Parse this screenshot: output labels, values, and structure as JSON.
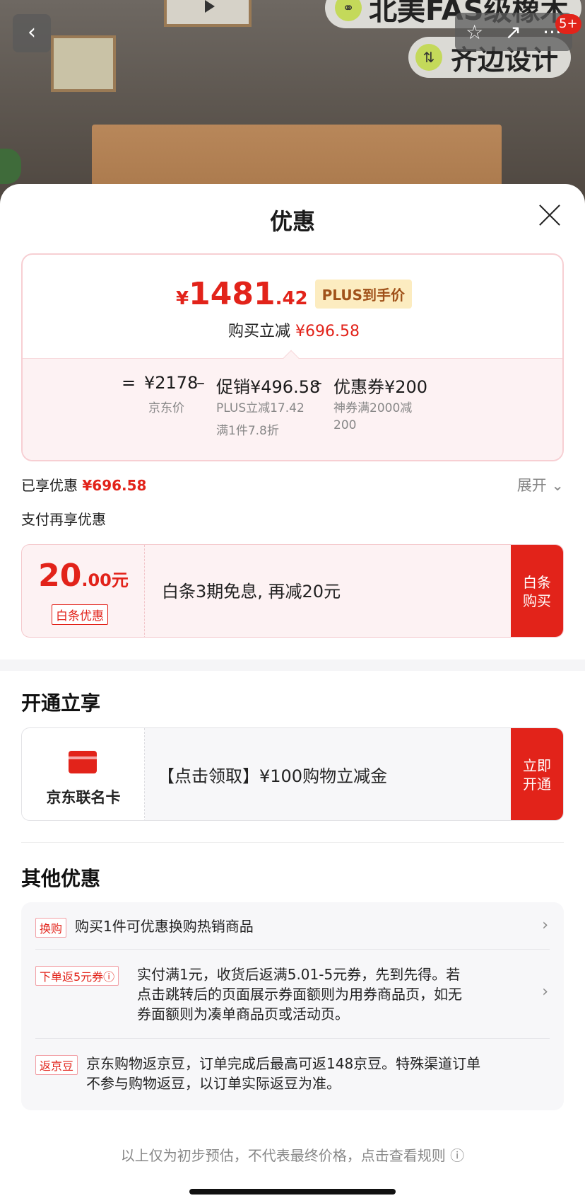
{
  "background": {
    "feature_1": "北美FAS级橡木",
    "feature_2": "齐边设计",
    "notification_count": "5+",
    "back_glyph": "‹",
    "star_glyph": "☆",
    "share_glyph": "↗",
    "more_glyph": "···",
    "feature_1_icon": "⚭",
    "feature_2_icon": "⇅"
  },
  "sheet": {
    "title": "优惠"
  },
  "price_card": {
    "currency": "¥",
    "price_int": "1481",
    "price_dec": ".42",
    "plus_label": "PLUS到手价",
    "reduce_label": "购买立减",
    "reduce_value": "¥696.58",
    "formula": {
      "equals": "=",
      "jd_price": "¥2178",
      "minus_1": "–",
      "promo": "促销¥496.58",
      "minus_2": "–",
      "coupon": "优惠券¥200",
      "jd_price_sub": "京东价",
      "promo_sub_1": "PLUS立减17.42",
      "promo_sub_2": "满1件7.8折",
      "coupon_sub_1": "神券满2000减",
      "coupon_sub_2": "200"
    }
  },
  "enjoyed": {
    "label": "已享优惠",
    "value": "¥696.58",
    "expand_label": "展开",
    "expand_icon": "⌄"
  },
  "pay_more": {
    "label": "支付再享优惠"
  },
  "baitiao": {
    "amount_int": "20",
    "amount_dec": ".00元",
    "tag": "白条优惠",
    "text": "白条3期免息, 再减20元",
    "button_line1": "白条",
    "button_line2": "购买"
  },
  "open_section": {
    "title": "开通立享",
    "card_name": "京东联名卡",
    "text": "【点击领取】¥100购物立减金",
    "button_line1": "立即",
    "button_line2": "开通"
  },
  "other_section": {
    "title": "其他优惠",
    "items": [
      {
        "tag": "换购",
        "text": "购买1件可优惠换购热销商品",
        "arrow": "›"
      },
      {
        "tag": "下单返5元券ⓘ",
        "text_line1": "实付满1元，收货后返满5.01-5元券，先到先得。若",
        "text_line2": "点击跳转后的页面展示券面额则为用券商品页，如无",
        "text_line3": "券面额则为凑单商品页或活动页。",
        "arrow": "›"
      },
      {
        "tag": "返京豆",
        "text_line1": "京东购物返京豆，订单完成后最高可返148京豆。特殊渠道订单",
        "text_line2": "不参与购物返豆，以订单实际返豆为准。"
      }
    ]
  },
  "footer": {
    "note": "以上仅为初步预估，不代表最终价格，点击查看规则 ⓘ"
  },
  "colors": {
    "accent": "#e2231a",
    "plus_bg": "#fcecc0",
    "plus_text": "#a0521a",
    "muted": "#888888"
  }
}
